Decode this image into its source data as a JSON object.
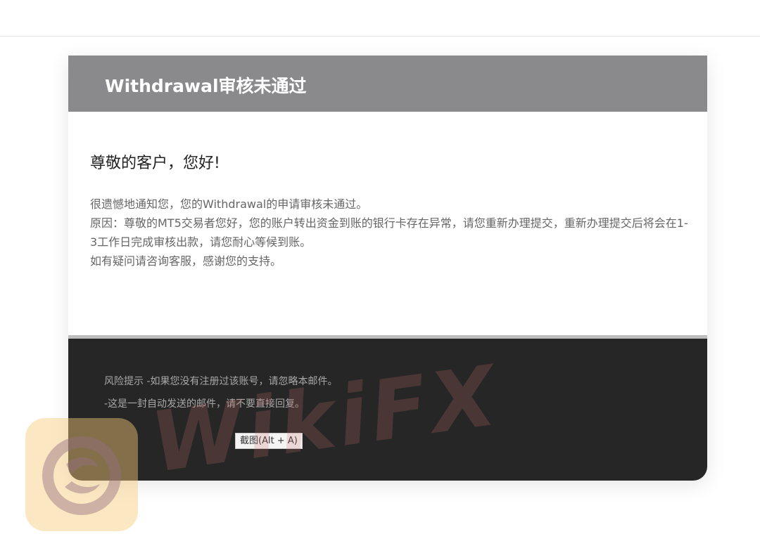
{
  "header": {
    "title": "Withdrawal审核未通过"
  },
  "body": {
    "greeting": "尊敬的客户，您好!",
    "lines": [
      "很遗憾地通知您，您的Withdrawal的申请审核未通过。",
      "原因：尊敬的MT5交易者您好，您的账户转出资金到账的银行卡存在异常，请您重新办理提交，重新办理提交后将会在1-3工作日完成审核出款，请您耐心等候到账。",
      "如有疑问请咨询客服，感谢您的支持。"
    ]
  },
  "footer": {
    "risk_notice": "风险提示 -如果您没有注册过该账号，请忽略本邮件。",
    "auto_notice": "-这是一封自动发送的邮件，请不要直接回复。"
  },
  "tooltip": {
    "label": "截图(Alt + A)"
  },
  "watermark": {
    "text": "WikiFX",
    "logo_icon": "wikifx-logo-icon"
  },
  "colors": {
    "header_bg": "#8a8a8c",
    "footer_bg": "#262626",
    "divider": "#bdbdbd"
  }
}
